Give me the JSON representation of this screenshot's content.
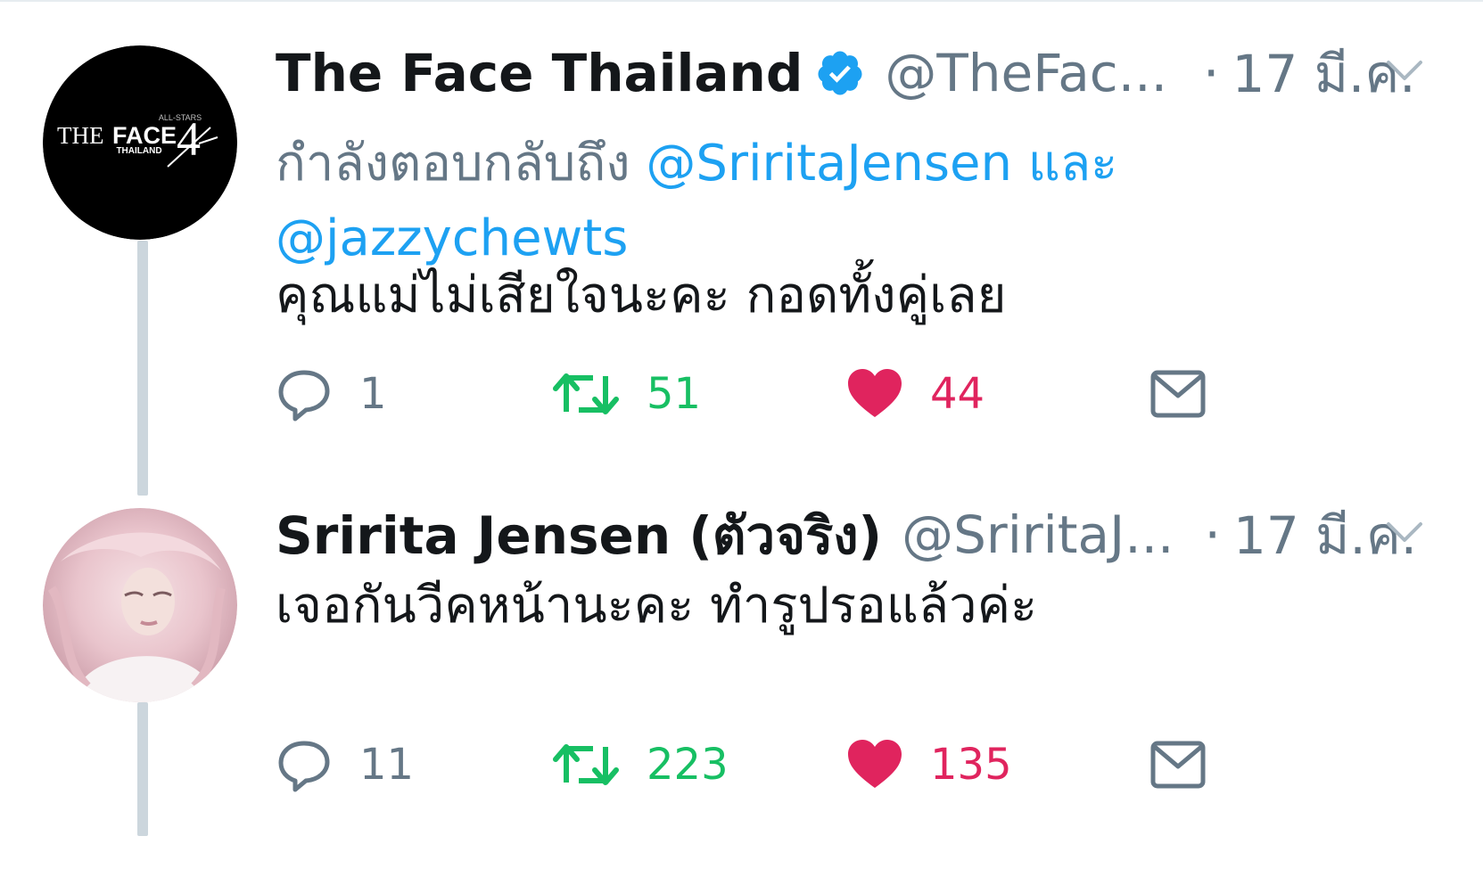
{
  "colors": {
    "link": "#1da1f2",
    "muted": "#657786",
    "retweet": "#17bf63",
    "like": "#e0245e",
    "thread_line": "#ccd6dd"
  },
  "avatar_text": {
    "top": "ALL-STARS",
    "main_a": "THE",
    "main_b": "FACE",
    "number": "4",
    "sub": "THAILAND"
  },
  "tweets": [
    {
      "display_name": "The Face Thailand",
      "verified": true,
      "handle": "@TheFac...",
      "separator": "·",
      "date": "17 มี.ค.",
      "reply_prefix": "กำลังตอบกลับถึง ",
      "reply_mention_1": "@SriritaJensen",
      "reply_and": " และ ",
      "reply_mention_2": "@jazzychewts",
      "text": "คุณแม่ไม่เสียใจนะคะ กอดทั้งคู่เลย",
      "replies": "1",
      "retweets": "51",
      "likes": "44",
      "liked": true,
      "icons": [
        "reply-icon",
        "retweet-icon",
        "heart-icon",
        "mail-icon",
        "chevron-down-icon",
        "verified-badge-icon"
      ]
    },
    {
      "display_name": "Sririta Jensen (ตัวจริง)",
      "verified": false,
      "handle": "@SriritaJ...",
      "separator": "·",
      "date": "17 มี.ค.",
      "text": "เจอกันวีคหน้านะคะ ทำรูปรอแล้วค่ะ",
      "replies": "11",
      "retweets": "223",
      "likes": "135",
      "liked": true,
      "icons": [
        "reply-icon",
        "retweet-icon",
        "heart-icon",
        "mail-icon",
        "chevron-down-icon"
      ]
    }
  ]
}
